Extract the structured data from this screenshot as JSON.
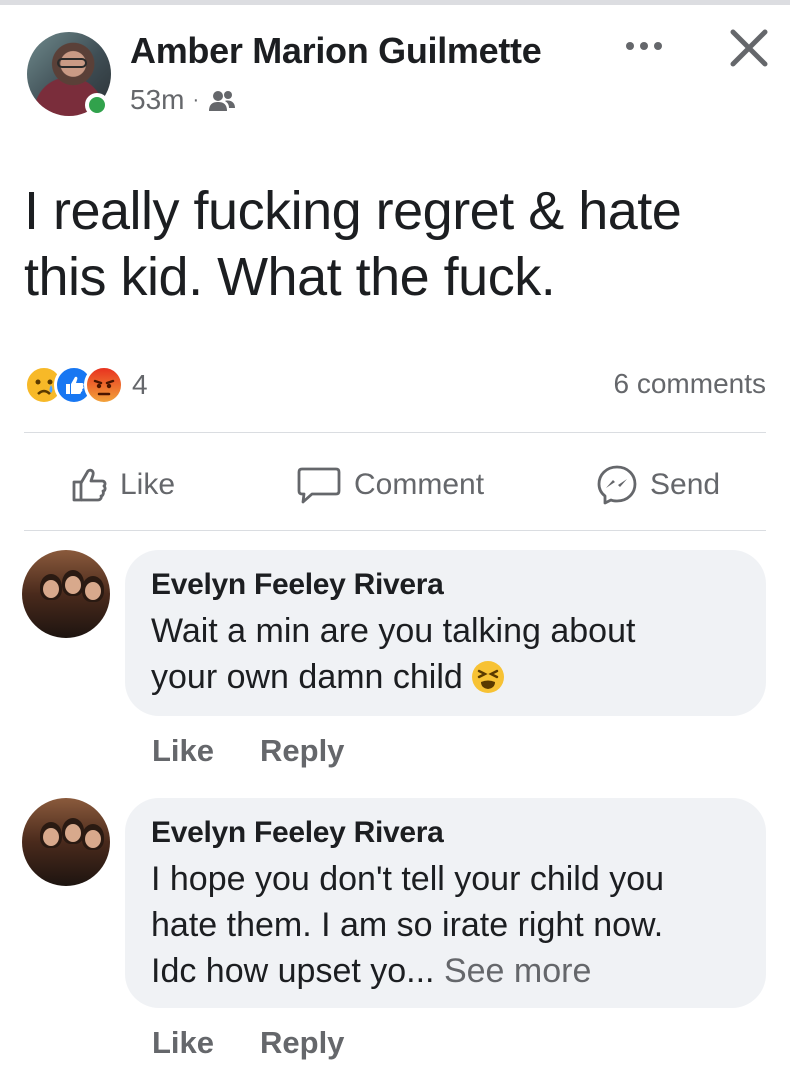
{
  "post": {
    "author": "Amber Marion Guilmette",
    "time": "53m",
    "separator": "·",
    "audience_icon": "friends-icon",
    "text_line1": "I really fucking regret & hate",
    "text_line2": "this kid. What the fuck.",
    "reaction_icons": [
      "sad-reaction-icon",
      "like-reaction-icon",
      "angry-reaction-icon"
    ],
    "reaction_count": "4",
    "comment_count": "6 comments"
  },
  "actions": {
    "like": "Like",
    "comment": "Comment",
    "send": "Send"
  },
  "comments": [
    {
      "author": "Evelyn Feeley Rivera",
      "text_line1": "Wait a min are you talking about",
      "text_line2": "your own damn child",
      "emoji": "tired-face-emoji",
      "like": "Like",
      "reply": "Reply"
    },
    {
      "author": "Evelyn Feeley Rivera",
      "text_line1": "I hope you don't tell your child you",
      "text_line2": "hate them. I am so irate right now.",
      "text_line3": "Idc how upset yo...",
      "see_more": "See more",
      "like": "Like",
      "reply": "Reply"
    }
  ],
  "colors": {
    "text": "#1c1e21",
    "secondary": "#65676b",
    "bubble": "#f0f2f5",
    "online": "#31a24c",
    "like_blue": "#1877f2",
    "angry": "#e9710f",
    "sad_yellow": "#f7b928"
  }
}
